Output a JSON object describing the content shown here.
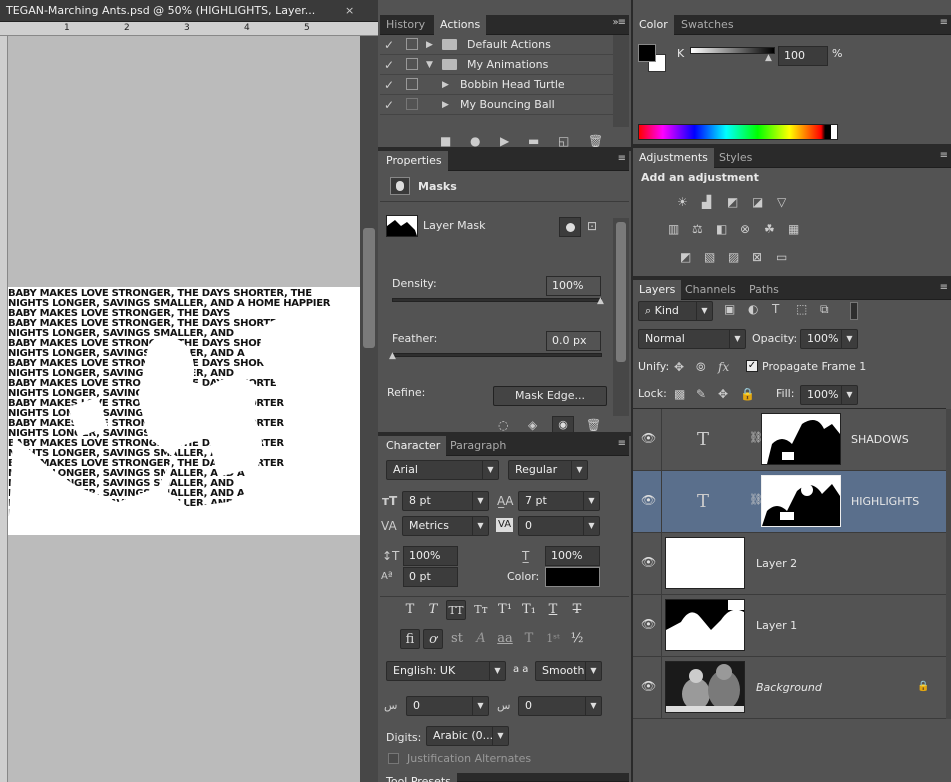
{
  "document": {
    "title": "TEGAN-Marching Ants.psd @ 50% (HIGHLIGHTS, Layer...",
    "close": "×",
    "ruler_marks": [
      "1",
      "2",
      "3",
      "4",
      "5"
    ],
    "text_lines": [
      "BABY MAKES LOVE STRONGER, THE DAYS SHORTER, THE",
      "NIGHTS LONGER, SAVINGS SMALLER, AND A HOME HAPPIER",
      "BABY MAKES LOVE STRONGER, THE DAYS",
      "BABY MAKES LOVE STRONGER, THE DAYS SHORTER",
      "NIGHTS LONGER, SAVINGS SMALLER, AND",
      "BABY MAKES LOVE STRONGER, THE DAYS SHORTER",
      "NIGHTS LONGER, SAVINGS SMALLER, AND A"
    ]
  },
  "history_actions": {
    "tabs": [
      "History",
      "Actions"
    ],
    "active_tab": "Actions",
    "items": [
      {
        "label": "Default Actions",
        "kind": "folder",
        "expanded": false
      },
      {
        "label": "My Animations",
        "kind": "folder",
        "expanded": true
      },
      {
        "label": "Bobbin Head Turtle",
        "kind": "action",
        "expanded": false
      },
      {
        "label": "My Bouncing Ball",
        "kind": "action",
        "expanded": false
      }
    ]
  },
  "properties": {
    "tab": "Properties",
    "section": "Masks",
    "mask_name": "Layer Mask",
    "density_label": "Density:",
    "density_value": "100%",
    "density_level": 1.0,
    "feather_label": "Feather:",
    "feather_value": "0.0 px",
    "feather_level": 0.0,
    "refine_label": "Refine:",
    "mask_edge_button": "Mask Edge..."
  },
  "character": {
    "tabs": [
      "Character",
      "Paragraph"
    ],
    "active_tab": "Character",
    "font_family": "Arial",
    "font_style": "Regular",
    "font_size": "8 pt",
    "leading": "7 pt",
    "kerning": "Metrics",
    "tracking": "0",
    "vertical_scale": "100%",
    "horizontal_scale": "100%",
    "baseline_shift": "0 pt",
    "color_label": "Color:",
    "color": "#000000",
    "language": "English: UK",
    "aa_label": "a a",
    "antialias": "Smooth",
    "arabic_a": "0",
    "arabic_b": "0",
    "digits_label": "Digits:",
    "digits_value": "Arabic (0...",
    "justification_label": "Justification Alternates",
    "tool_presets_tab": "Tool Presets"
  },
  "color_panel": {
    "tabs": [
      "Color",
      "Swatches"
    ],
    "active_tab": "Color",
    "channel_label": "K",
    "channel_value": "100",
    "percent": "%",
    "foreground": "#000000",
    "background": "#ffffff"
  },
  "adjustments": {
    "tabs": [
      "Adjustments",
      "Styles"
    ],
    "active_tab": "Adjustments",
    "heading": "Add an adjustment"
  },
  "layers_panel": {
    "tabs": [
      "Layers",
      "Channels",
      "Paths"
    ],
    "active_tab": "Layers",
    "filter": "Kind",
    "blend_mode": "Normal",
    "opacity_label": "Opacity:",
    "opacity": "100%",
    "unify_label": "Unify:",
    "propagate_label": "Propagate Frame 1",
    "propagate_checked": true,
    "lock_label": "Lock:",
    "fill_label": "Fill:",
    "fill": "100%",
    "layers": [
      {
        "name": "SHADOWS",
        "type": "text",
        "selected": false
      },
      {
        "name": "HIGHLIGHTS",
        "type": "text",
        "selected": true
      },
      {
        "name": "Layer 2",
        "type": "pixel",
        "selected": false
      },
      {
        "name": "Layer 1",
        "type": "pixel",
        "selected": false
      },
      {
        "name": "Background",
        "type": "background",
        "selected": false,
        "locked": true
      }
    ]
  },
  "colors": {
    "panel_bg": "#535353",
    "selected_layer": "#5a6f8c",
    "tab_bar": "#2a2a2a"
  }
}
